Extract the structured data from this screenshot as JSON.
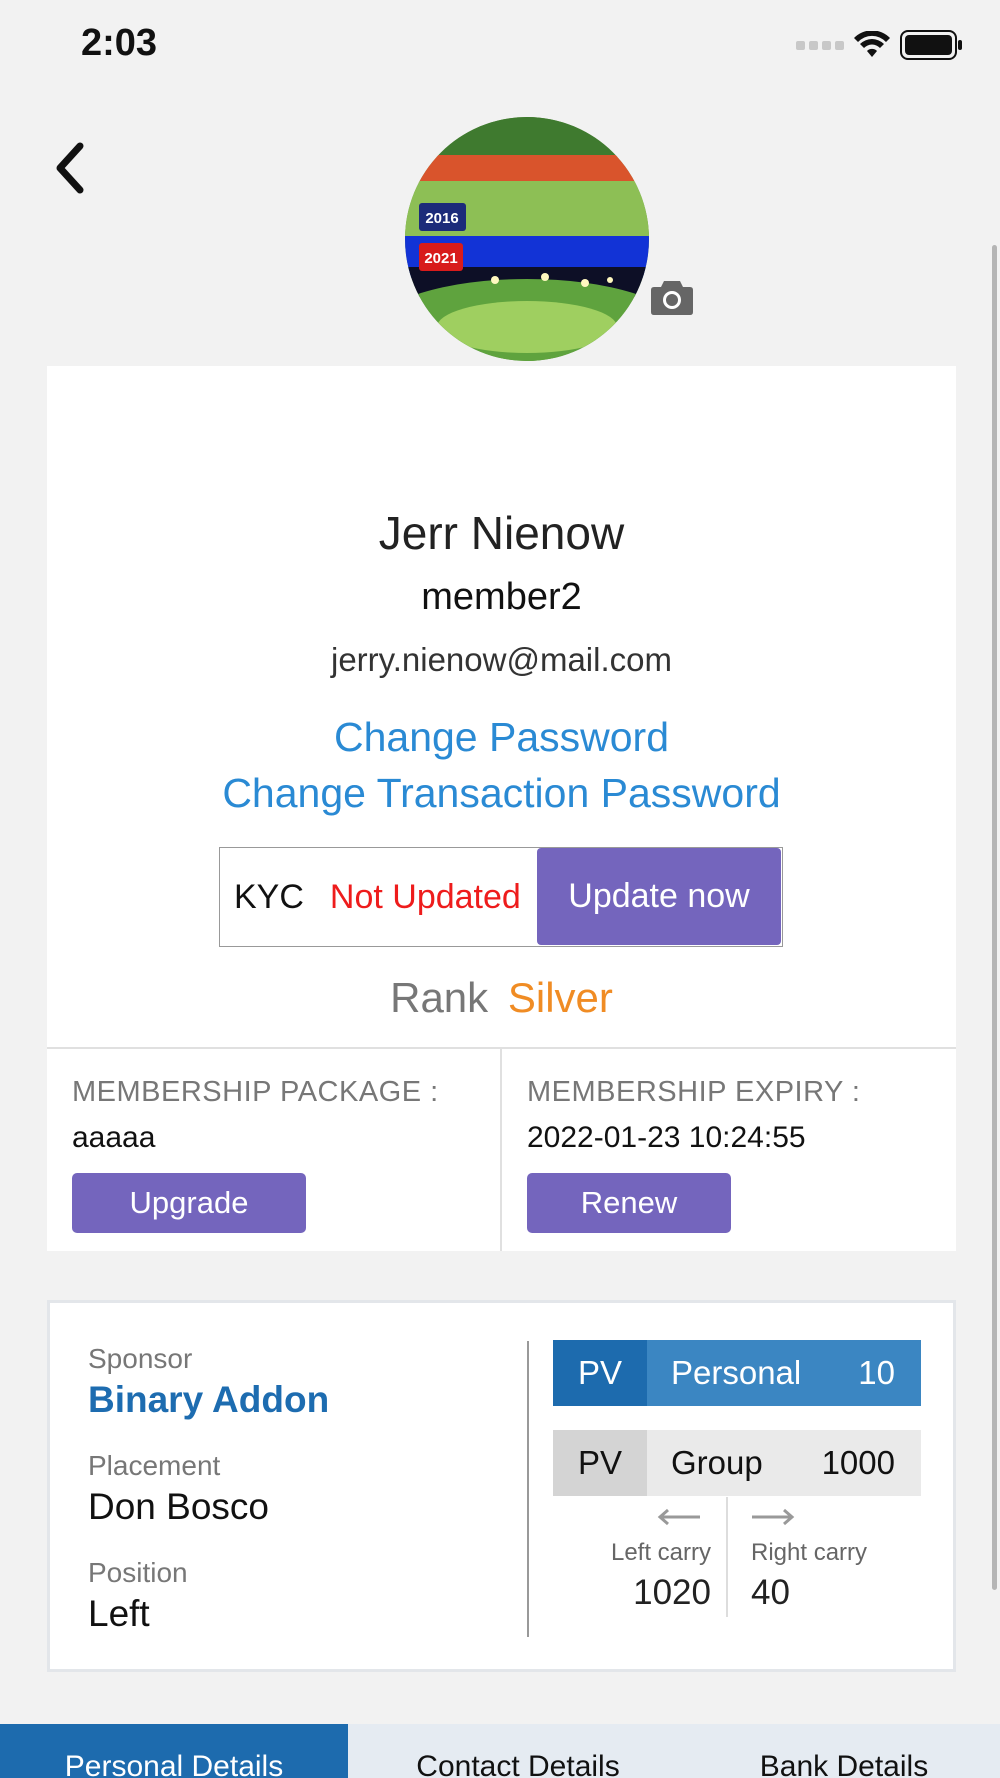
{
  "status_bar": {
    "time": "2:03",
    "icons": [
      "signal-icon",
      "wifi-icon",
      "battery-icon"
    ]
  },
  "header": {
    "back_icon": "chevron-left-icon",
    "avatar_badges": [
      "2016",
      "2021"
    ],
    "camera_icon": "camera-icon"
  },
  "profile": {
    "name": "Jerr Nienow",
    "username": "member2",
    "email": "jerry.nienow@mail.com",
    "change_password": "Change Password",
    "change_transaction_password": "Change Transaction Password"
  },
  "kyc": {
    "label": "KYC",
    "status": "Not Updated",
    "button": "Update now"
  },
  "rank": {
    "label": "Rank",
    "value": "Silver"
  },
  "membership": {
    "package_label": "MEMBERSHIP PACKAGE :",
    "package_value": "aaaaa",
    "upgrade_button": "Upgrade",
    "expiry_label": "MEMBERSHIP EXPIRY :",
    "expiry_value": "2022-01-23 10:24:55",
    "renew_button": "Renew"
  },
  "network": {
    "sponsor_label": "Sponsor",
    "sponsor_value": "Binary Addon",
    "placement_label": "Placement",
    "placement_value": "Don Bosco",
    "position_label": "Position",
    "position_value": "Left",
    "pv_personal": {
      "tag": "PV",
      "label": "Personal",
      "value": "10"
    },
    "pv_group": {
      "tag": "PV",
      "label": "Group",
      "value": "1000"
    },
    "left_carry_label": "Left carry",
    "left_carry_value": "1020",
    "right_carry_label": "Right carry",
    "right_carry_value": "40"
  },
  "tabs": [
    {
      "label": "Personal Details",
      "active": true
    },
    {
      "label": "Contact Details",
      "active": false
    },
    {
      "label": "Bank Details",
      "active": false
    }
  ],
  "colors": {
    "accent_purple": "#7465bd",
    "link_blue": "#2a8ad4",
    "primary_blue": "#1d6bae",
    "rank_orange": "#f08c24",
    "error_red": "#ee1c1c"
  }
}
